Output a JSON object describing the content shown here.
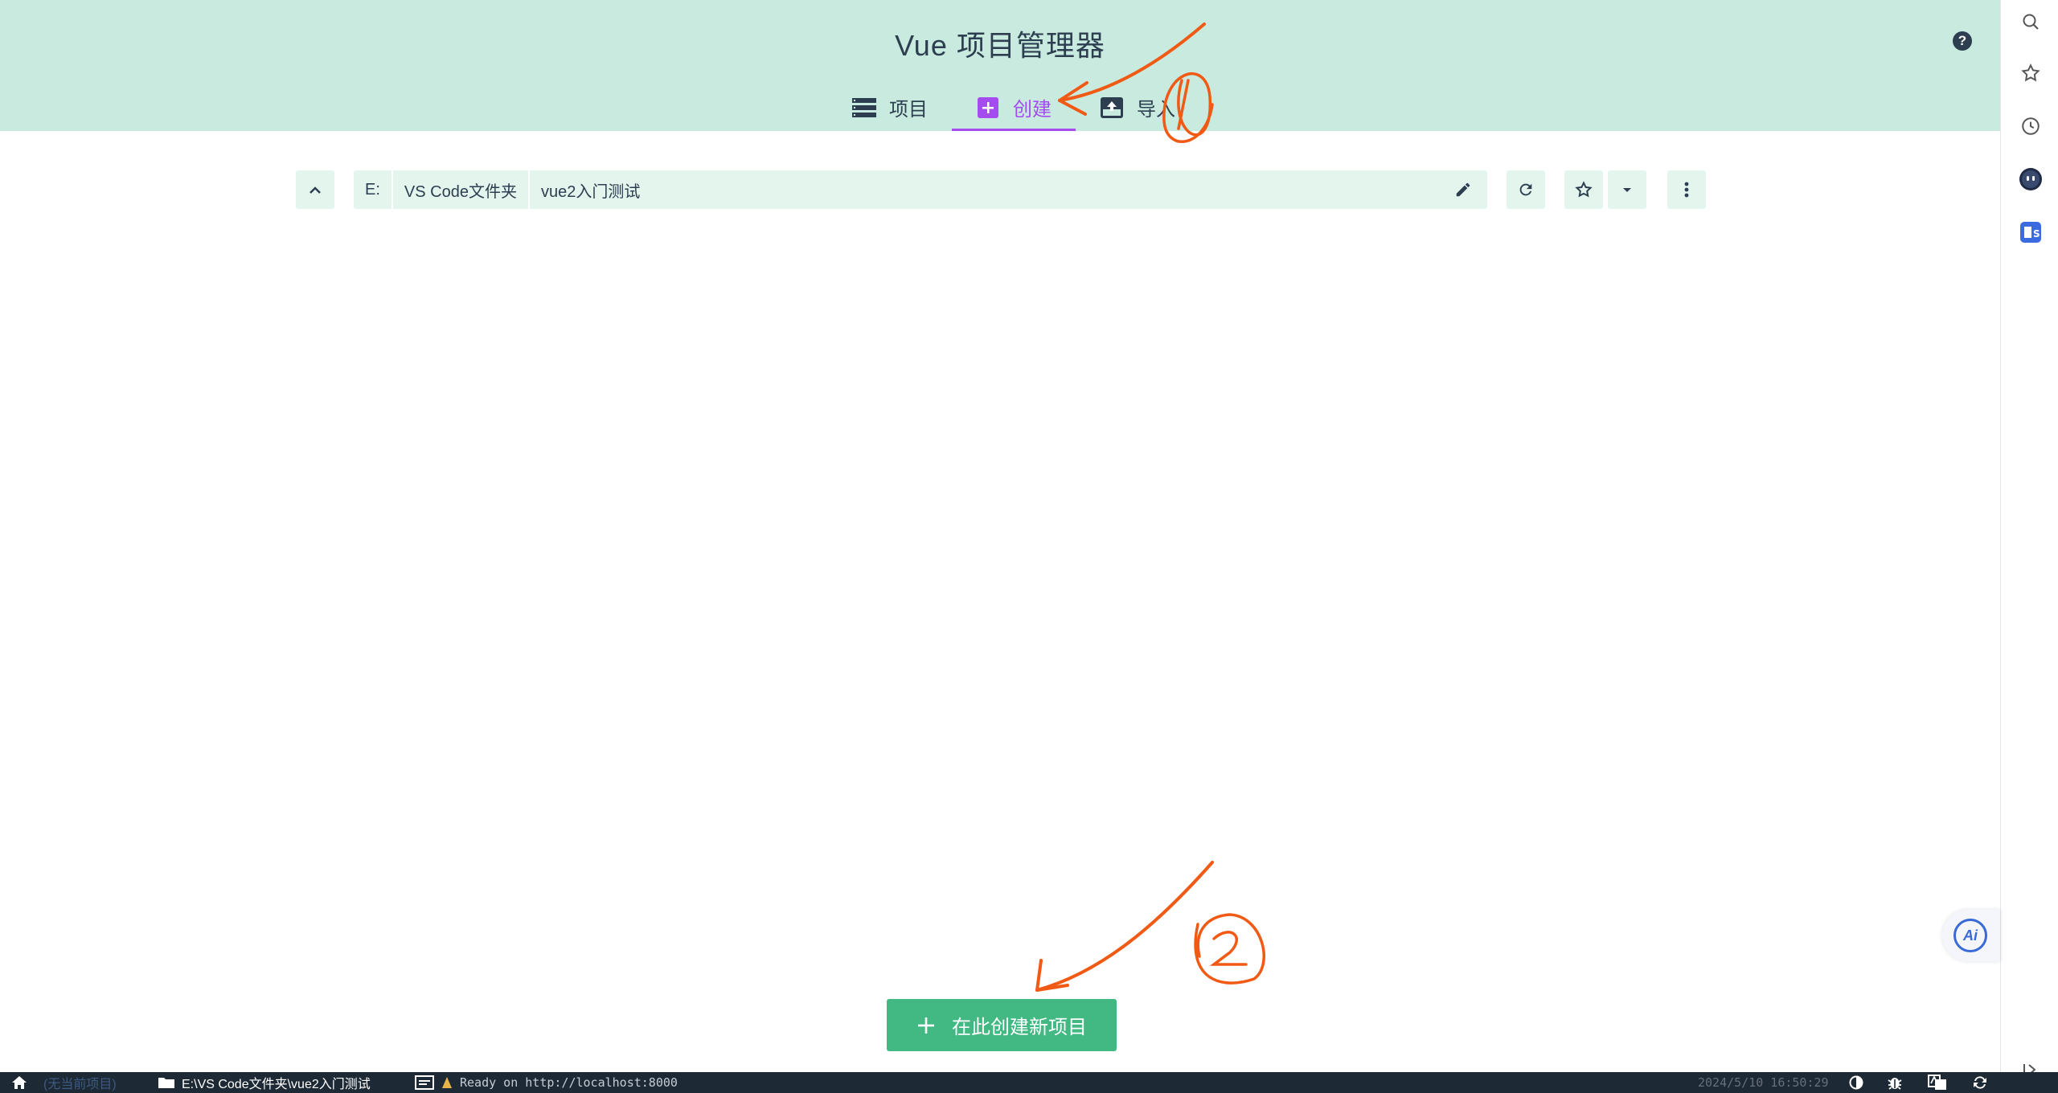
{
  "app": {
    "title": "Vue 项目管理器",
    "help_label": "?"
  },
  "tabs": [
    {
      "label": "项目",
      "icon": "list-icon"
    },
    {
      "label": "创建",
      "icon": "add-box-icon",
      "active": true
    },
    {
      "label": "导入",
      "icon": "unarchive-icon"
    }
  ],
  "path": {
    "segments": [
      "E:",
      "VS Code文件夹",
      "vue2入门测试"
    ]
  },
  "create_button": {
    "label": "在此创建新项目",
    "icon": "plus-icon"
  },
  "annotations": {
    "first": "1",
    "second": "2"
  },
  "right_bar": {
    "icons": [
      "search-icon",
      "star-icon",
      "history-icon",
      "extension-icon",
      "translate-icon"
    ],
    "ai_label": "Ai",
    "collapse_icon": "collapse-sidebar-icon"
  },
  "statusbar": {
    "no_project": "(无当前项目)",
    "cwd": "E:\\VS Code文件夹\\vue2入门测试",
    "log": "Ready on http://localhost:8000",
    "time": "2024/5/10 16:50:29"
  },
  "colors": {
    "header_bg": "#c9eade",
    "accent": "#a44cf0",
    "primary": "#42b983",
    "annotation": "#f05a14",
    "statusbar_bg": "#1d2935"
  }
}
